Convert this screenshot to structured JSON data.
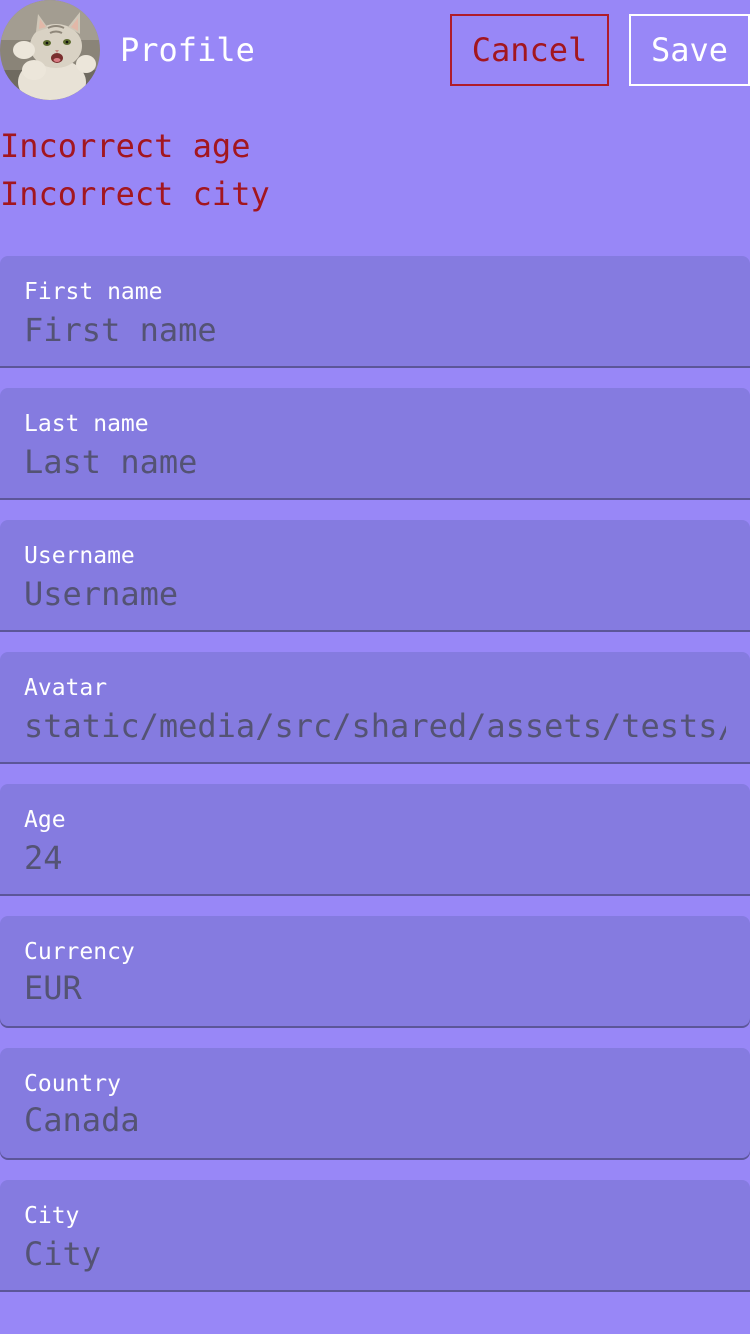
{
  "header": {
    "title": "Profile",
    "cancel_label": "Cancel",
    "save_label": "Save",
    "avatar_icon": "cat-photo"
  },
  "errors": [
    "Incorrect age",
    "Incorrect city"
  ],
  "fields": {
    "first_name": {
      "label": "First name",
      "value": "",
      "placeholder": "First name"
    },
    "last_name": {
      "label": "Last name",
      "value": "",
      "placeholder": "Last name"
    },
    "username": {
      "label": "Username",
      "value": "",
      "placeholder": "Username"
    },
    "avatar": {
      "label": "Avatar",
      "value": "static/media/src/shared/assets/tests/"
    },
    "age": {
      "label": "Age",
      "value": "24"
    },
    "currency": {
      "label": "Currency",
      "value": "EUR"
    },
    "country": {
      "label": "Country",
      "value": "Canada"
    },
    "city": {
      "label": "City",
      "value": "",
      "placeholder": "City"
    }
  },
  "colors": {
    "background": "#9887f7",
    "field_bg": "#857be0",
    "error": "#a3161f",
    "text_primary": "#ffffff",
    "text_muted": "#545374"
  }
}
